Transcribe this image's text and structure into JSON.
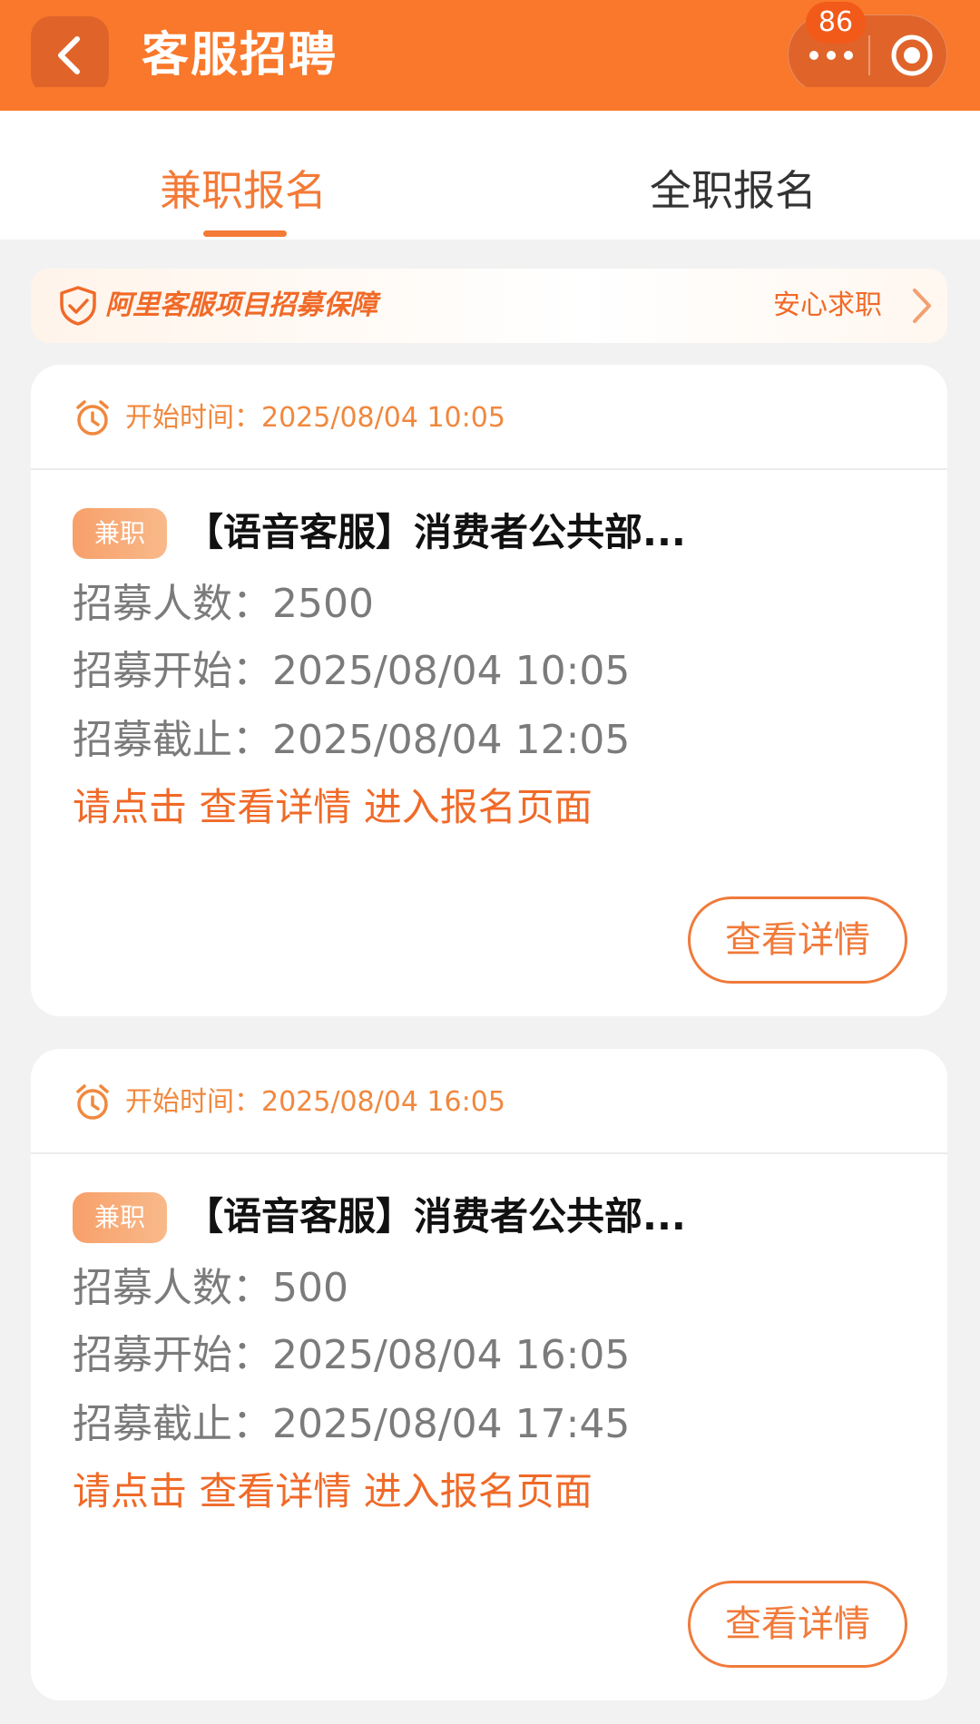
{
  "header": {
    "title": "客服招聘",
    "badge_count": "86",
    "colors": {
      "brand": "#f9782b",
      "accent": "#f06a28"
    }
  },
  "tabs": [
    {
      "label": "兼职报名",
      "active": true
    },
    {
      "label": "全职报名",
      "active": false
    }
  ],
  "guarantee": {
    "text": "阿里客服项目招募保障",
    "link": "安心求职",
    "icon": "shield-check-icon"
  },
  "jobs": [
    {
      "start_label": "开始时间：2025/08/04 10:05",
      "tag": "兼职",
      "title": "【语音客服】消费者公共部...",
      "count_line": "招募人数：2500",
      "start_line": "招募开始：2025/08/04 10:05",
      "end_line": "招募截止：2025/08/04 12:05",
      "hint": "请点击 查看详情 进入报名页面",
      "button": "查看详情"
    },
    {
      "start_label": "开始时间：2025/08/04 16:05",
      "tag": "兼职",
      "title": "【语音客服】消费者公共部...",
      "count_line": "招募人数：500",
      "start_line": "招募开始：2025/08/04 16:05",
      "end_line": "招募截止：2025/08/04 17:45",
      "hint": "请点击 查看详情 进入报名页面",
      "button": "查看详情"
    }
  ]
}
